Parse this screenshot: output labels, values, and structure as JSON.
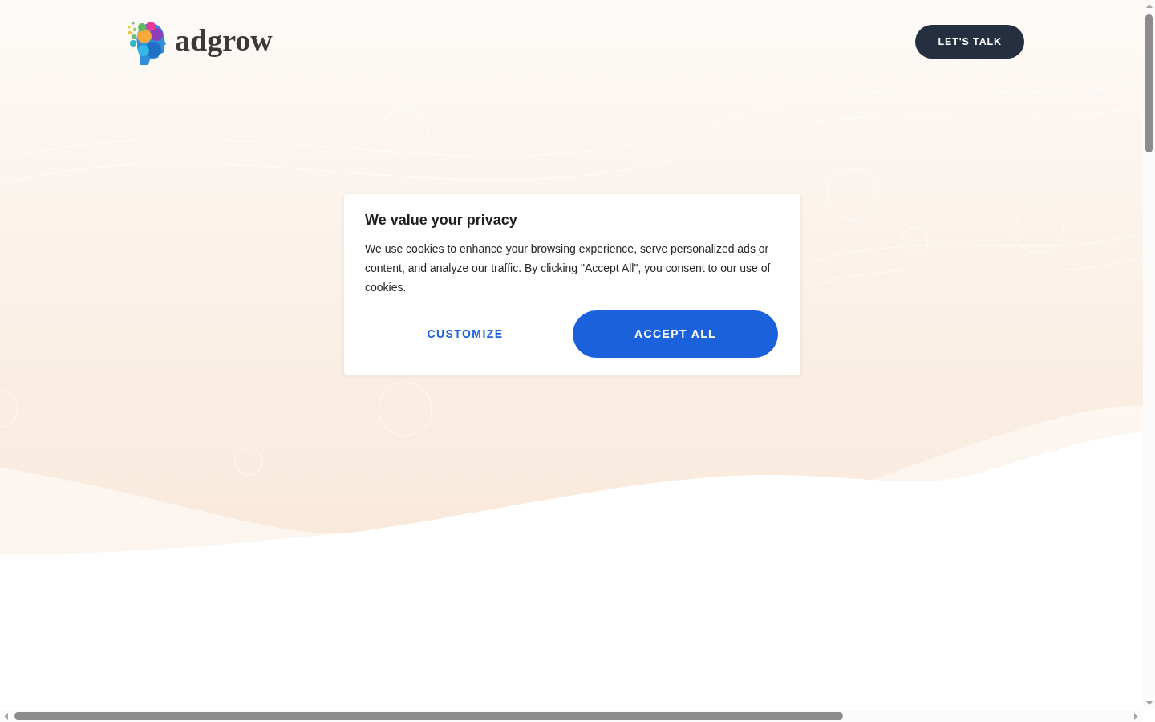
{
  "header": {
    "logo": {
      "wordmark": "adgrow"
    },
    "cta_button": "LET'S TALK"
  },
  "cookie_dialog": {
    "title": "We value your privacy",
    "message": "We use cookies to enhance your browsing experience, serve personalized ads or content, and analyze our traffic. By clicking \"Accept All\", you consent to our use of cookies.",
    "buttons": [
      {
        "label": "CUSTOMIZE",
        "kind": "text"
      },
      {
        "label": "ACCEPT ALL",
        "kind": "primary"
      }
    ]
  }
}
